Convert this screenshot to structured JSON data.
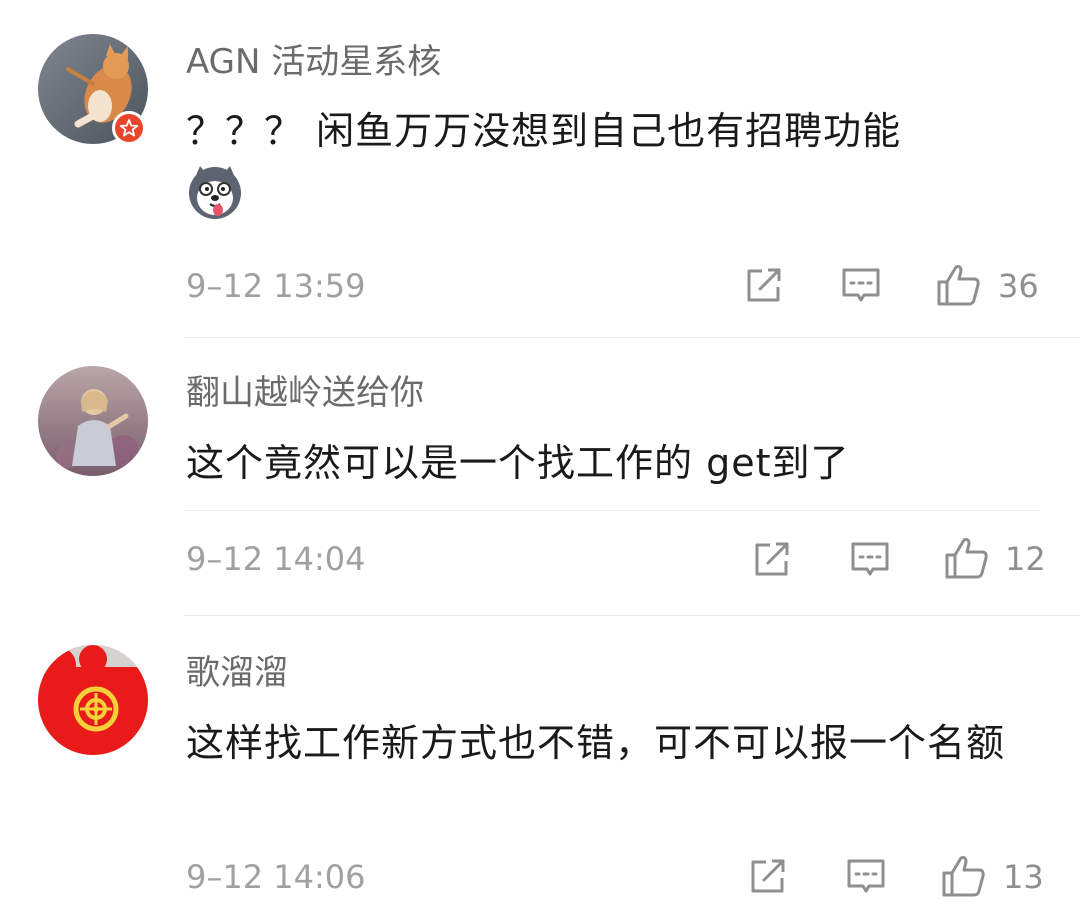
{
  "comments": [
    {
      "user": "AGN 活动星系核",
      "text": "？？？ 闲鱼万万没想到自己也有招聘功能",
      "emoji": "husky-emoji",
      "time": "9–12 13:59",
      "likes": "36",
      "avatar": "cat-avatar",
      "badge": "star-badge-icon"
    },
    {
      "user": "翻山越岭送给你",
      "text": "这个竟然可以是一个找工作的 get到了",
      "time": "9–12 14:04",
      "likes": "12",
      "avatar": "girl-field-avatar"
    },
    {
      "user": "歌溜溜",
      "text": "这样找工作新方式也不错，可不可以报一个名额",
      "time": "9–12 14:06",
      "likes": "13",
      "avatar": "red-plush-avatar"
    }
  ],
  "colors": {
    "username": "#6b6b6b",
    "text": "#1a1a1a",
    "time": "#a0a0a0",
    "icon": "#8f8f8f",
    "badge": "#e8452d",
    "divider": "#e6e6e6"
  }
}
